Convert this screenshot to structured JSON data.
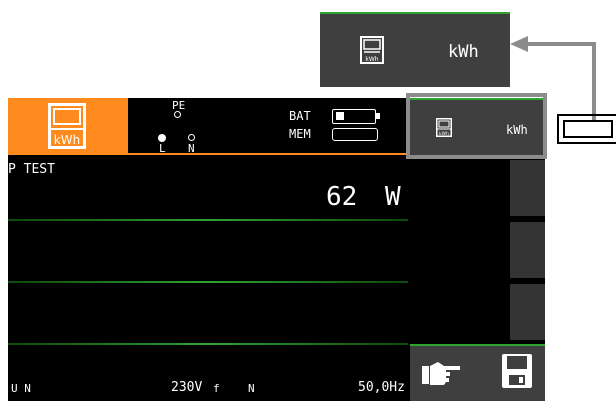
{
  "colors": {
    "accent": "#ff8a1e",
    "green": "#2fa32f",
    "bg": "#000000",
    "button": "#3f3f3f"
  },
  "zoom": {
    "icon": "kwh-meter-icon",
    "icon_label": "kWh",
    "label": "kWh"
  },
  "header": {
    "icon": "kwh-meter-icon",
    "icon_label": "kWh",
    "pe": "PE",
    "l": "L",
    "n": "N",
    "bat": "BAT",
    "mem": "MEM"
  },
  "softkey": {
    "icon": "kwh-meter-icon",
    "icon_label": "kWh",
    "label": "kWh"
  },
  "main": {
    "title": "P TEST",
    "value": "62",
    "unit": "W"
  },
  "footer": {
    "un": "U N",
    "voltage": "230V",
    "f": "f",
    "n": "N",
    "freq": "50,0Hz"
  },
  "buttons": {
    "pointer_icon": "pointing-hand-icon",
    "save_icon": "floppy-disk-icon"
  }
}
